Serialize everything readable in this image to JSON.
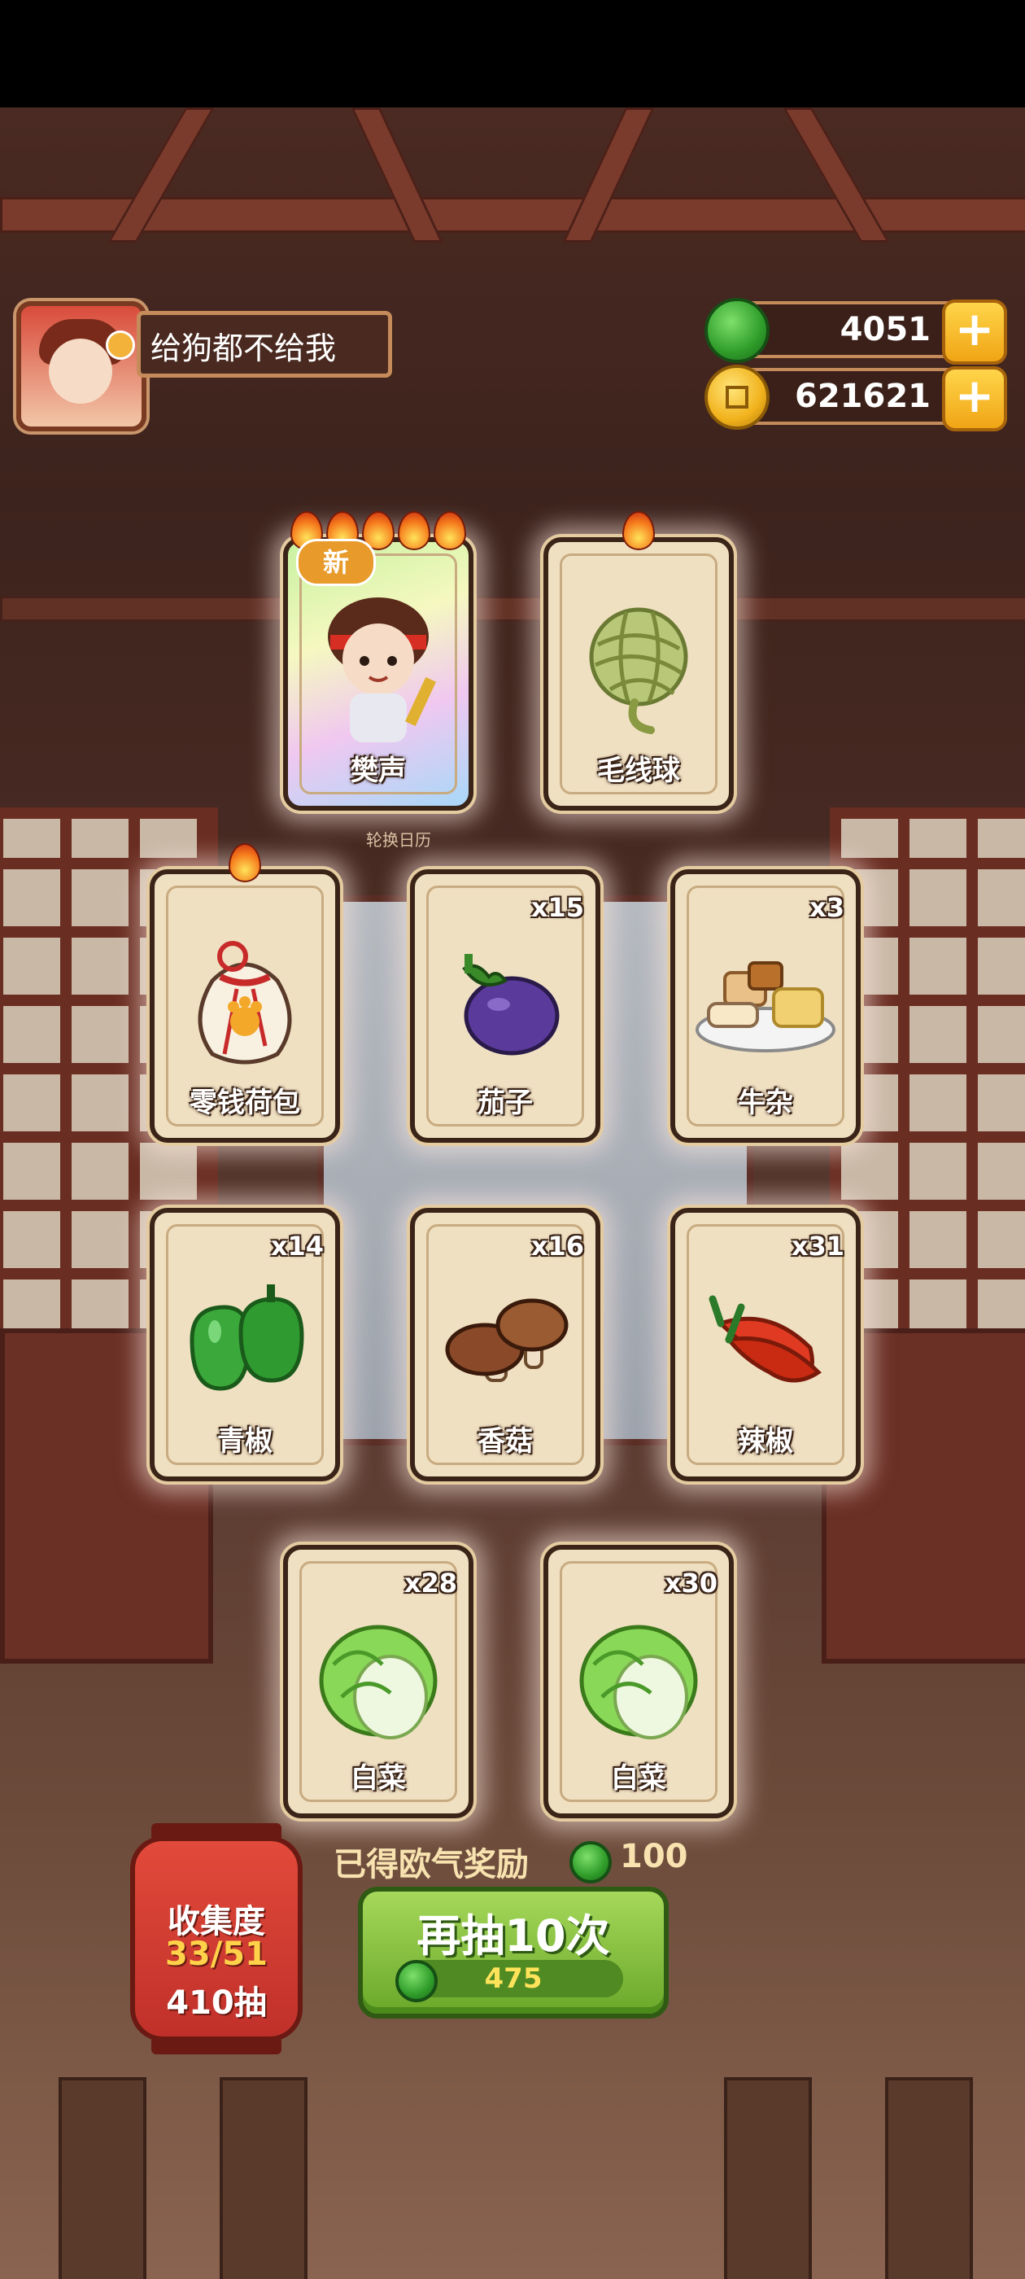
{
  "player": {
    "name": "给狗都不给我"
  },
  "currencies": {
    "jade": {
      "value": "4051",
      "icon": "jade-icon",
      "color": "#3aa82e"
    },
    "coins": {
      "value": "621621",
      "icon": "coin-icon",
      "color": "#f1b21c"
    }
  },
  "background": {
    "rotate_label": "轮换日历"
  },
  "cards": [
    {
      "name": "樊声",
      "count": "",
      "rarity_flames": 5,
      "is_new": true,
      "new_label": "新",
      "icon": "character-fansheng"
    },
    {
      "name": "毛线球",
      "count": "",
      "rarity_flames": 1,
      "is_new": false,
      "icon": "yarn-ball-icon"
    },
    {
      "name": "零钱荷包",
      "count": "",
      "rarity_flames": 1,
      "is_new": false,
      "icon": "coin-pouch-icon"
    },
    {
      "name": "茄子",
      "count": "x15",
      "rarity_flames": 0,
      "is_new": false,
      "icon": "eggplant-icon"
    },
    {
      "name": "牛杂",
      "count": "x3",
      "rarity_flames": 0,
      "is_new": false,
      "icon": "beef-offal-icon"
    },
    {
      "name": "青椒",
      "count": "x14",
      "rarity_flames": 0,
      "is_new": false,
      "icon": "green-pepper-icon"
    },
    {
      "name": "香菇",
      "count": "x16",
      "rarity_flames": 0,
      "is_new": false,
      "icon": "mushroom-icon"
    },
    {
      "name": "辣椒",
      "count": "x31",
      "rarity_flames": 0,
      "is_new": false,
      "icon": "chili-icon"
    },
    {
      "name": "白菜",
      "count": "x28",
      "rarity_flames": 0,
      "is_new": false,
      "icon": "cabbage-icon"
    },
    {
      "name": "白菜",
      "count": "x30",
      "rarity_flames": 0,
      "is_new": false,
      "icon": "cabbage-icon"
    }
  ],
  "collection": {
    "title": "收集度",
    "progress": "33/51",
    "draws": "410抽"
  },
  "reward": {
    "label": "已得欧气奖励",
    "amount": "100"
  },
  "draw_button": {
    "label": "再抽10次",
    "cost": "475"
  }
}
